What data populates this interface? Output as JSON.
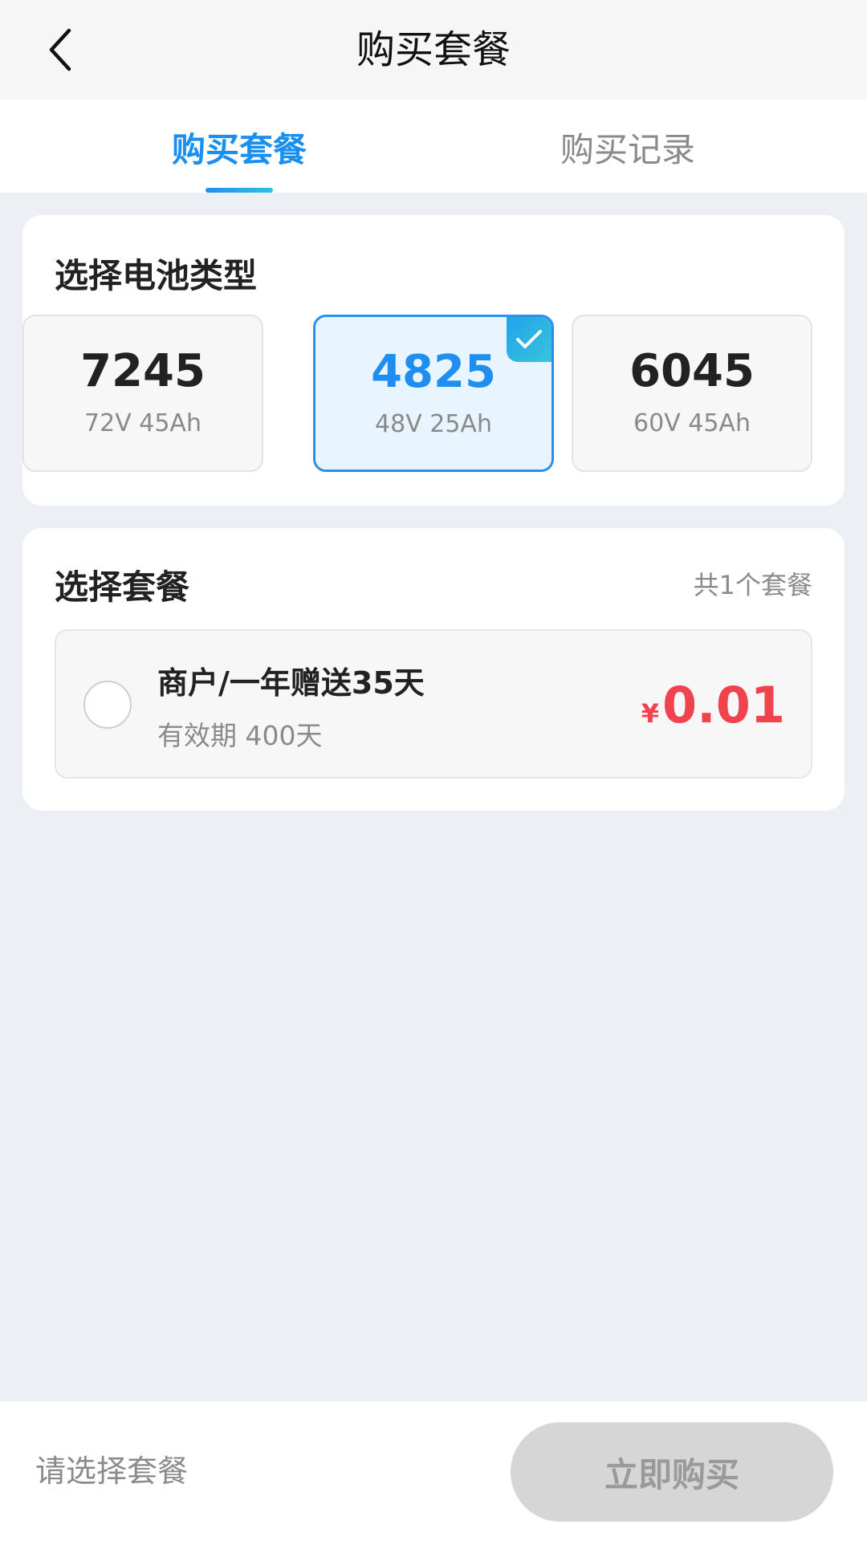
{
  "header": {
    "title": "购买套餐",
    "back_icon": "chevron-left-icon"
  },
  "tabs": [
    {
      "label": "购买套餐",
      "active": true
    },
    {
      "label": "购买记录",
      "active": false
    }
  ],
  "battery_section": {
    "title": "选择电池类型",
    "options": [
      {
        "code": "4825",
        "spec": "48V 25Ah",
        "selected": true
      },
      {
        "code": "6045",
        "spec": "60V 45Ah",
        "selected": false
      },
      {
        "code": "7245",
        "spec": "72V 45Ah",
        "selected": false
      }
    ]
  },
  "package_section": {
    "title": "选择套餐",
    "count_label": "共1个套餐",
    "items": [
      {
        "name": "商户/一年赠送35天",
        "validity": "有效期 400天",
        "price_symbol": "¥",
        "price": "0.01",
        "selected": false
      }
    ]
  },
  "bottom_bar": {
    "hint": "请选择套餐",
    "buy_label": "立即购买"
  },
  "colors": {
    "accent": "#1f8ef0",
    "price": "#f0434e",
    "background": "#eceff4",
    "button_disabled": "#d6d6d6"
  }
}
